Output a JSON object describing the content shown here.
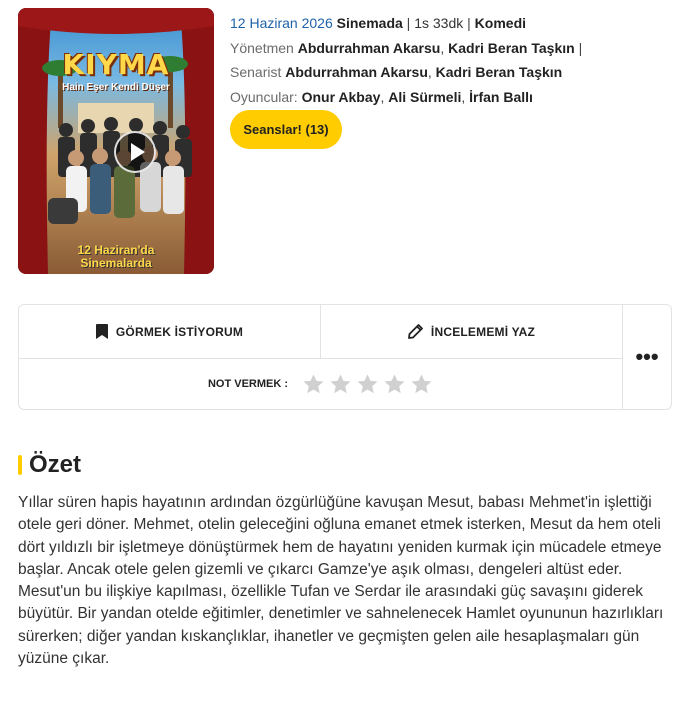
{
  "poster": {
    "title": "KIYMA",
    "tagline": "Hain Eşer Kendi Düşer",
    "date_line1": "12 Haziran'da",
    "date_line2": "Sinemalarda"
  },
  "meta": {
    "release_date": "12 Haziran 2026",
    "status": "Sinemada",
    "duration": "1s 33dk",
    "genre": "Komedi",
    "directors_label": "Yönetmen",
    "directors": [
      "Abdurrahman Akarsu",
      "Kadri Beran Taşkın"
    ],
    "writers_label": "Senarist",
    "writers": [
      "Abdurrahman Akarsu",
      "Kadri Beran Taşkın"
    ],
    "cast_label": "Oyuncular:",
    "cast": [
      "Onur Akbay",
      "Ali Sürmeli",
      "İrfan Ballı"
    ]
  },
  "sessions_button": "Seanslar! (13)",
  "actions": {
    "want_to_watch": "GÖRMEK İSTİYORUM",
    "write_review": "İNCELEMEMİ YAZ",
    "rate_label": "NOT VERMEK :",
    "rating_value": 0,
    "rating_max": 5,
    "more": "•••"
  },
  "summary": {
    "title": "Özet",
    "text": "Yıllar süren hapis hayatının ardından özgürlüğüne kavuşan Mesut, babası Mehmet'in işlettiği otele geri döner. Mehmet, otelin geleceğini oğluna emanet etmek isterken, Mesut da hem oteli dört yıldızlı bir işletmeye dönüştürmek hem de hayatını yeniden kurmak için mücadele etmeye başlar. Ancak otele gelen gizemli ve çıkarcı Gamze'ye aşık olması, dengeleri altüst eder. Mesut'un bu ilişkiye kapılması, özellikle Tufan ve Serdar ile arasındaki güç savaşını giderek büyütür. Bir yandan otelde eğitimler, denetimler ve sahnelenecek Hamlet oyununun hazırlıkları sürerken; diğer yandan kıskançlıklar, ihanetler ve geçmişten gelen aile hesaplaşmaları gün yüzüne çıkar."
  },
  "colors": {
    "accent": "#ffcc00",
    "link_blue": "#1f62a8",
    "star_empty": "#d0d0d0"
  }
}
